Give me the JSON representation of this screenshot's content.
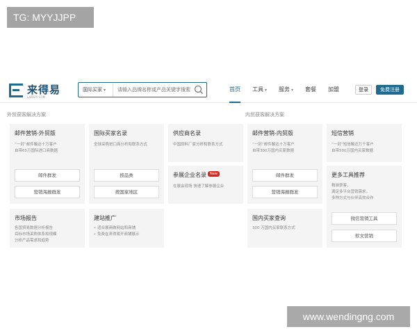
{
  "tag": "TG: MYYJJPP",
  "watermark": "www.wendingng.com",
  "header": {
    "logo_text": "来得易",
    "logo_sub": "LAIDEYI.COM",
    "search_select": "国际买家",
    "search_placeholder": "请输入品牌名称或产品关键字搜索",
    "nav": [
      "首页",
      "工具",
      "服务",
      "套餐",
      "加盟"
    ],
    "login": "登录",
    "register": "免费注册"
  },
  "sections": {
    "foreign": "外贸获客解决方案",
    "domestic": "内贸获客解决方案"
  },
  "cards": {
    "email_foreign": {
      "title": "邮件营销-外贸版",
      "desc": [
        "“一封”邮件触达十万客户",
        "自带65万国际进口商数据"
      ],
      "btn1": "邮件群发",
      "btn2": "营销海报群发"
    },
    "buyers": {
      "title": "国际买家名录",
      "desc": [
        "全球采购进口商分析和联系方式"
      ],
      "btn1": "按品类",
      "btn2": "按国家地区"
    },
    "supplier": {
      "title": "供应商名录",
      "desc": [
        "中国原料厂家分析和联系方式"
      ]
    },
    "expo": {
      "title": "参展企业名录",
      "badge": "New",
      "desc": [
        "在展会现场 快速了解参展企业"
      ]
    },
    "email_domestic": {
      "title": "邮件营销-内贸版",
      "desc": [
        "“一封”邮件触达十万客户",
        "自带300万国内买家数据"
      ],
      "btn1": "邮件群发",
      "btn2": "营销海报群发"
    },
    "sms": {
      "title": "短信营销",
      "desc": [
        "“一封”短信触达万千客户",
        "自带500万国内买家数据"
      ]
    },
    "more_tools": {
      "title": "更多工具推荐",
      "desc": [
        "精准获客，",
        "满足多平台营销需求，",
        "多种方式与伙伴高效合作"
      ],
      "btn1": "微信营销工具",
      "btn2": "软文营销"
    },
    "report": {
      "title": "市场报告",
      "desc": [
        "各国贸易数据分析报告",
        "目标市场采购体系和规模",
        "分析产品需求和趋势"
      ]
    },
    "site": {
      "title": "建站推广",
      "desc": [
        "• 适合展商做网站和商铺",
        "• 免费在来得易开商铺展示"
      ]
    },
    "domestic_buyers": {
      "title": "国内买家查询",
      "desc": [
        "300 万国内买家联系方式"
      ]
    }
  },
  "colors": {
    "brand": "#1f6b8e",
    "badge": "#d9251c"
  }
}
